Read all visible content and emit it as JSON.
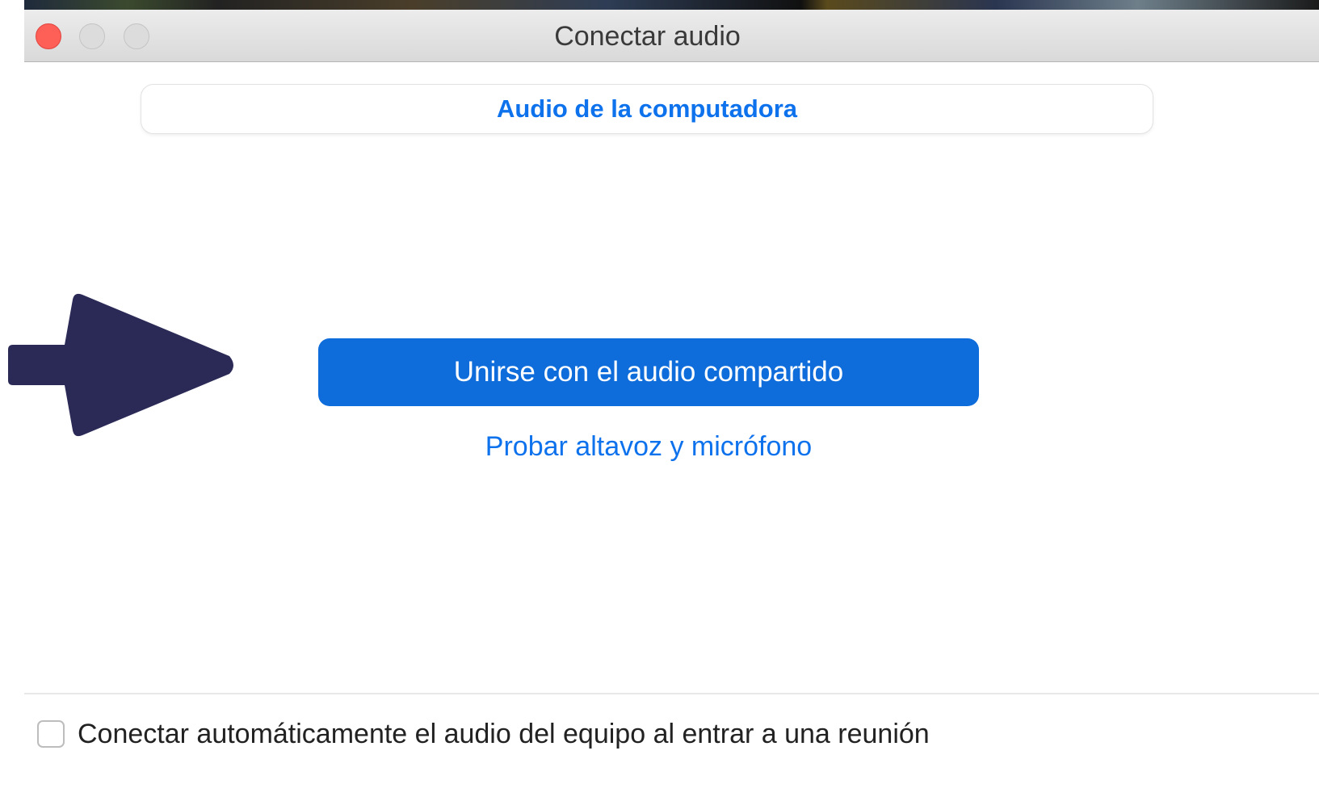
{
  "window": {
    "title": "Conectar audio"
  },
  "tabs": [
    {
      "label": "Audio de la computadora",
      "active": true
    }
  ],
  "main": {
    "join_button_label": "Unirse con el audio compartido",
    "test_link_label": "Probar altavoz y micrófono"
  },
  "footer": {
    "auto_connect_label": "Conectar automáticamente el audio del equipo al entrar a una reunión",
    "auto_connect_checked": false
  },
  "colors": {
    "accent": "#0e72ed",
    "primary_button": "#0e6cdb",
    "close_button": "#fe5f57",
    "annotation_arrow": "#2b2a57"
  },
  "icons": {
    "annotation": "arrow-right-icon"
  }
}
